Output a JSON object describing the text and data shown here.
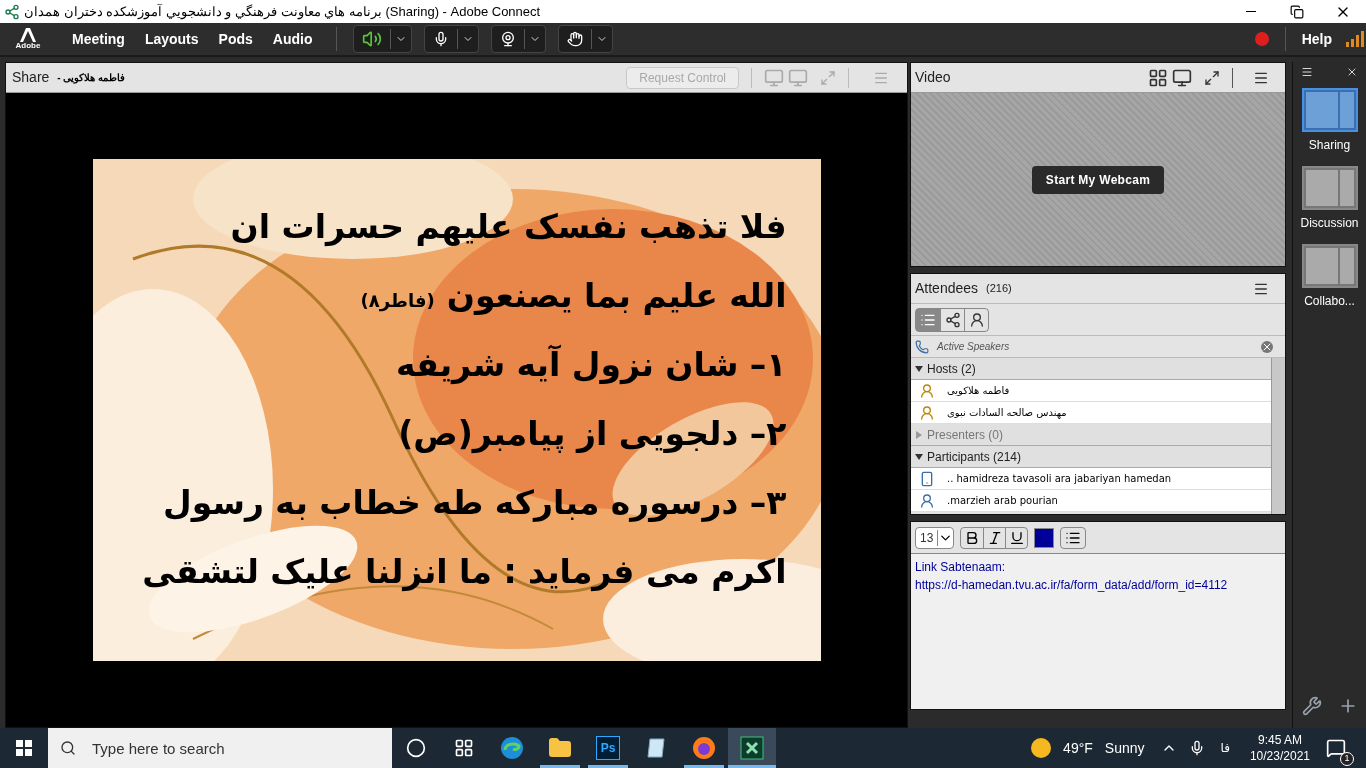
{
  "window": {
    "title": "برنامه هاي معاونت فرهنگي و دانشجويي آموزشكده دختران همدان (Sharing) - Adobe Connect"
  },
  "menu": [
    "Meeting",
    "Layouts",
    "Pods",
    "Audio"
  ],
  "menu_logo": "Adobe",
  "audio": {
    "on": true
  },
  "recording": {
    "on": true
  },
  "help": "Help",
  "share": {
    "title": "Share",
    "presenter": "- فاطمه هلاکویی",
    "request_control": {
      "label": "Request Control",
      "disabled": true
    },
    "slide": {
      "lines": [
        {
          "text": "فلا تذهب نفسک علیهم حسرات ان"
        },
        {
          "text": "الله علیم بما یصنعون",
          "note": "(فاطر۸)"
        },
        {
          "text": "۱– شان نزول آیه شریفه"
        },
        {
          "text": "۲– دلجویی از پیامبر(ص)"
        },
        {
          "text": "۳– درسوره مبارکه طه خطاب به رسول"
        },
        {
          "text": "اکرم  می فرماید : ما انزلنا علیک لتشقی"
        }
      ]
    }
  },
  "video": {
    "title": "Video",
    "button": "Start My Webcam"
  },
  "attendees": {
    "title": "Attendees",
    "count": "(216)",
    "active_speakers": "Active Speakers",
    "groups": [
      {
        "label": "Hosts (2)",
        "expanded": true,
        "people": [
          {
            "name": "فاطمه هلاکویی",
            "kind": "host"
          },
          {
            "name": "مهندس صالحه السادات نبوی",
            "kind": "host"
          }
        ]
      },
      {
        "label": "Presenters (0)",
        "expanded": false
      },
      {
        "label": "Participants (214)",
        "expanded": true,
        "people": [
          {
            "name": ".. hamidreza tavasoli ara jabariyan hamedan",
            "kind": "phone"
          },
          {
            "name": ".marzieh arab pourian",
            "kind": "user"
          }
        ]
      }
    ]
  },
  "chat": {
    "font_size": "13",
    "color": "#000099",
    "lines": [
      "Link Sabtenaam:",
      "https://d-hamedan.tvu.ac.ir/fa/form_data/add/form_id=4112"
    ]
  },
  "layouts": [
    {
      "label": "Sharing",
      "selected": true
    },
    {
      "label": "Discussion",
      "selected": false
    },
    {
      "label": "Collabo...",
      "selected": false
    }
  ],
  "taskbar": {
    "search": {
      "placeholder": "Type here to search"
    },
    "apps": [
      {
        "kind": "edge",
        "running": false,
        "selected": false
      },
      {
        "kind": "folder",
        "running": true,
        "selected": false
      },
      {
        "kind": "photoshop",
        "label": "Ps",
        "running": true,
        "selected": false
      },
      {
        "kind": "notepad",
        "running": false,
        "selected": false
      },
      {
        "kind": "firefox",
        "running": true,
        "selected": false
      },
      {
        "kind": "connect",
        "running": true,
        "selected": true
      }
    ],
    "temperature": "49°F",
    "weather": "Sunny",
    "language": "فا",
    "time": "9:45 AM",
    "date": "10/23/2021",
    "notifications": "1"
  }
}
